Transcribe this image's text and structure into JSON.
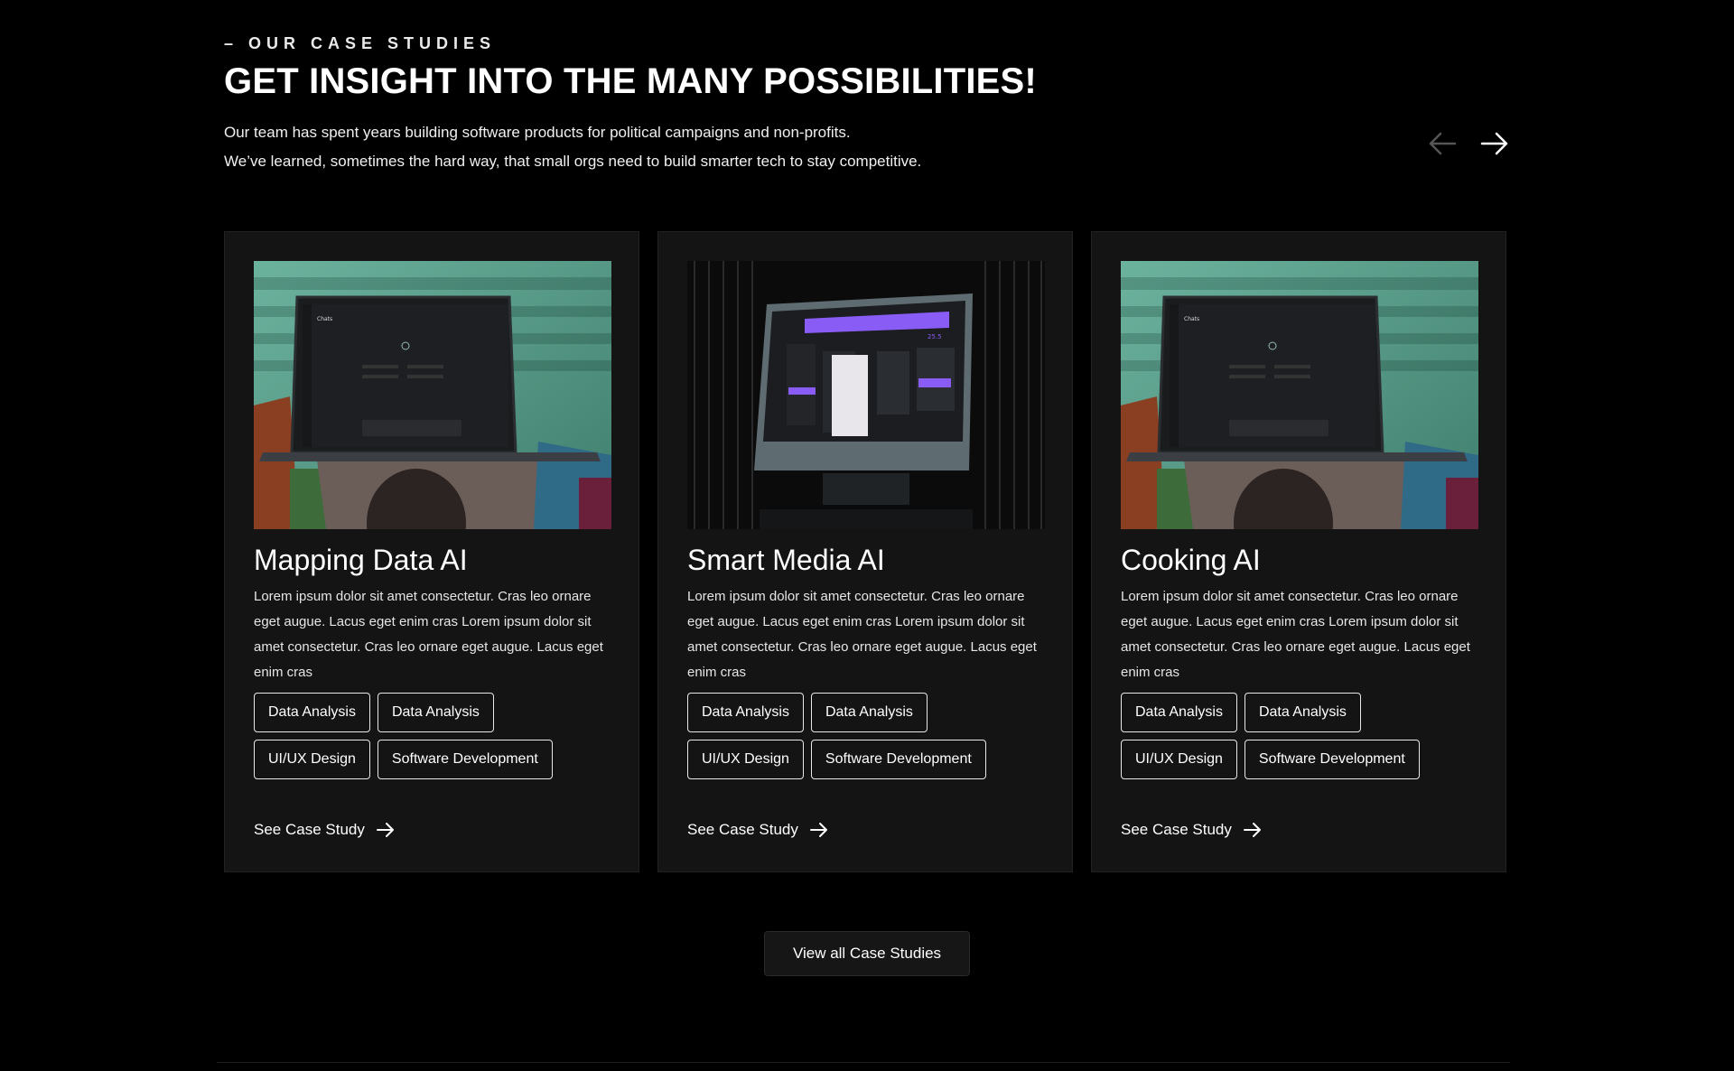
{
  "header": {
    "eyebrow": "– OUR CASE STUDIES",
    "title": "GET INSIGHT INTO THE MANY POSSIBILITIES!",
    "intro_line1": "Our team has spent years building software products for political campaigns and non-profits.",
    "intro_line2": "We’ve learned, sometimes the hard way, that small orgs need to build smarter tech to stay competitive."
  },
  "carousel": {
    "prev_icon": "arrow-left-icon",
    "next_icon": "arrow-right-icon"
  },
  "cards": [
    {
      "title": "Mapping Data AI",
      "description": "Lorem ipsum dolor sit amet consectetur. Cras leo ornare eget augue. Lacus eget enim cras Lorem ipsum dolor sit amet consectetur. Cras leo ornare eget augue. Lacus eget enim cras",
      "tags": [
        "Data Analysis",
        "Data Analysis",
        "UI/UX Design",
        "Software Development"
      ],
      "cta": "See Case Study",
      "image_screen_title": "Chats"
    },
    {
      "title": "Smart Media AI",
      "description": "Lorem ipsum dolor sit amet consectetur. Cras leo ornare eget augue. Lacus eget enim cras Lorem ipsum dolor sit amet consectetur. Cras leo ornare eget augue. Lacus eget enim cras",
      "tags": [
        "Data Analysis",
        "Data Analysis",
        "UI/UX Design",
        "Software Development"
      ],
      "cta": "See Case Study"
    },
    {
      "title": "Cooking AI",
      "description": "Lorem ipsum dolor sit amet consectetur. Cras leo ornare eget augue. Lacus eget enim cras Lorem ipsum dolor sit amet consectetur. Cras leo ornare eget augue. Lacus eget enim cras",
      "tags": [
        "Data Analysis",
        "Data Analysis",
        "UI/UX Design",
        "Software Development"
      ],
      "cta": "See Case Study",
      "image_screen_title": "Chats"
    }
  ],
  "footer": {
    "view_all": "View all Case Studies"
  },
  "colors": {
    "background": "#000000",
    "card": "#141414",
    "image_wall": "#5e9e8a",
    "screen_accent": "#8a5cf6"
  }
}
